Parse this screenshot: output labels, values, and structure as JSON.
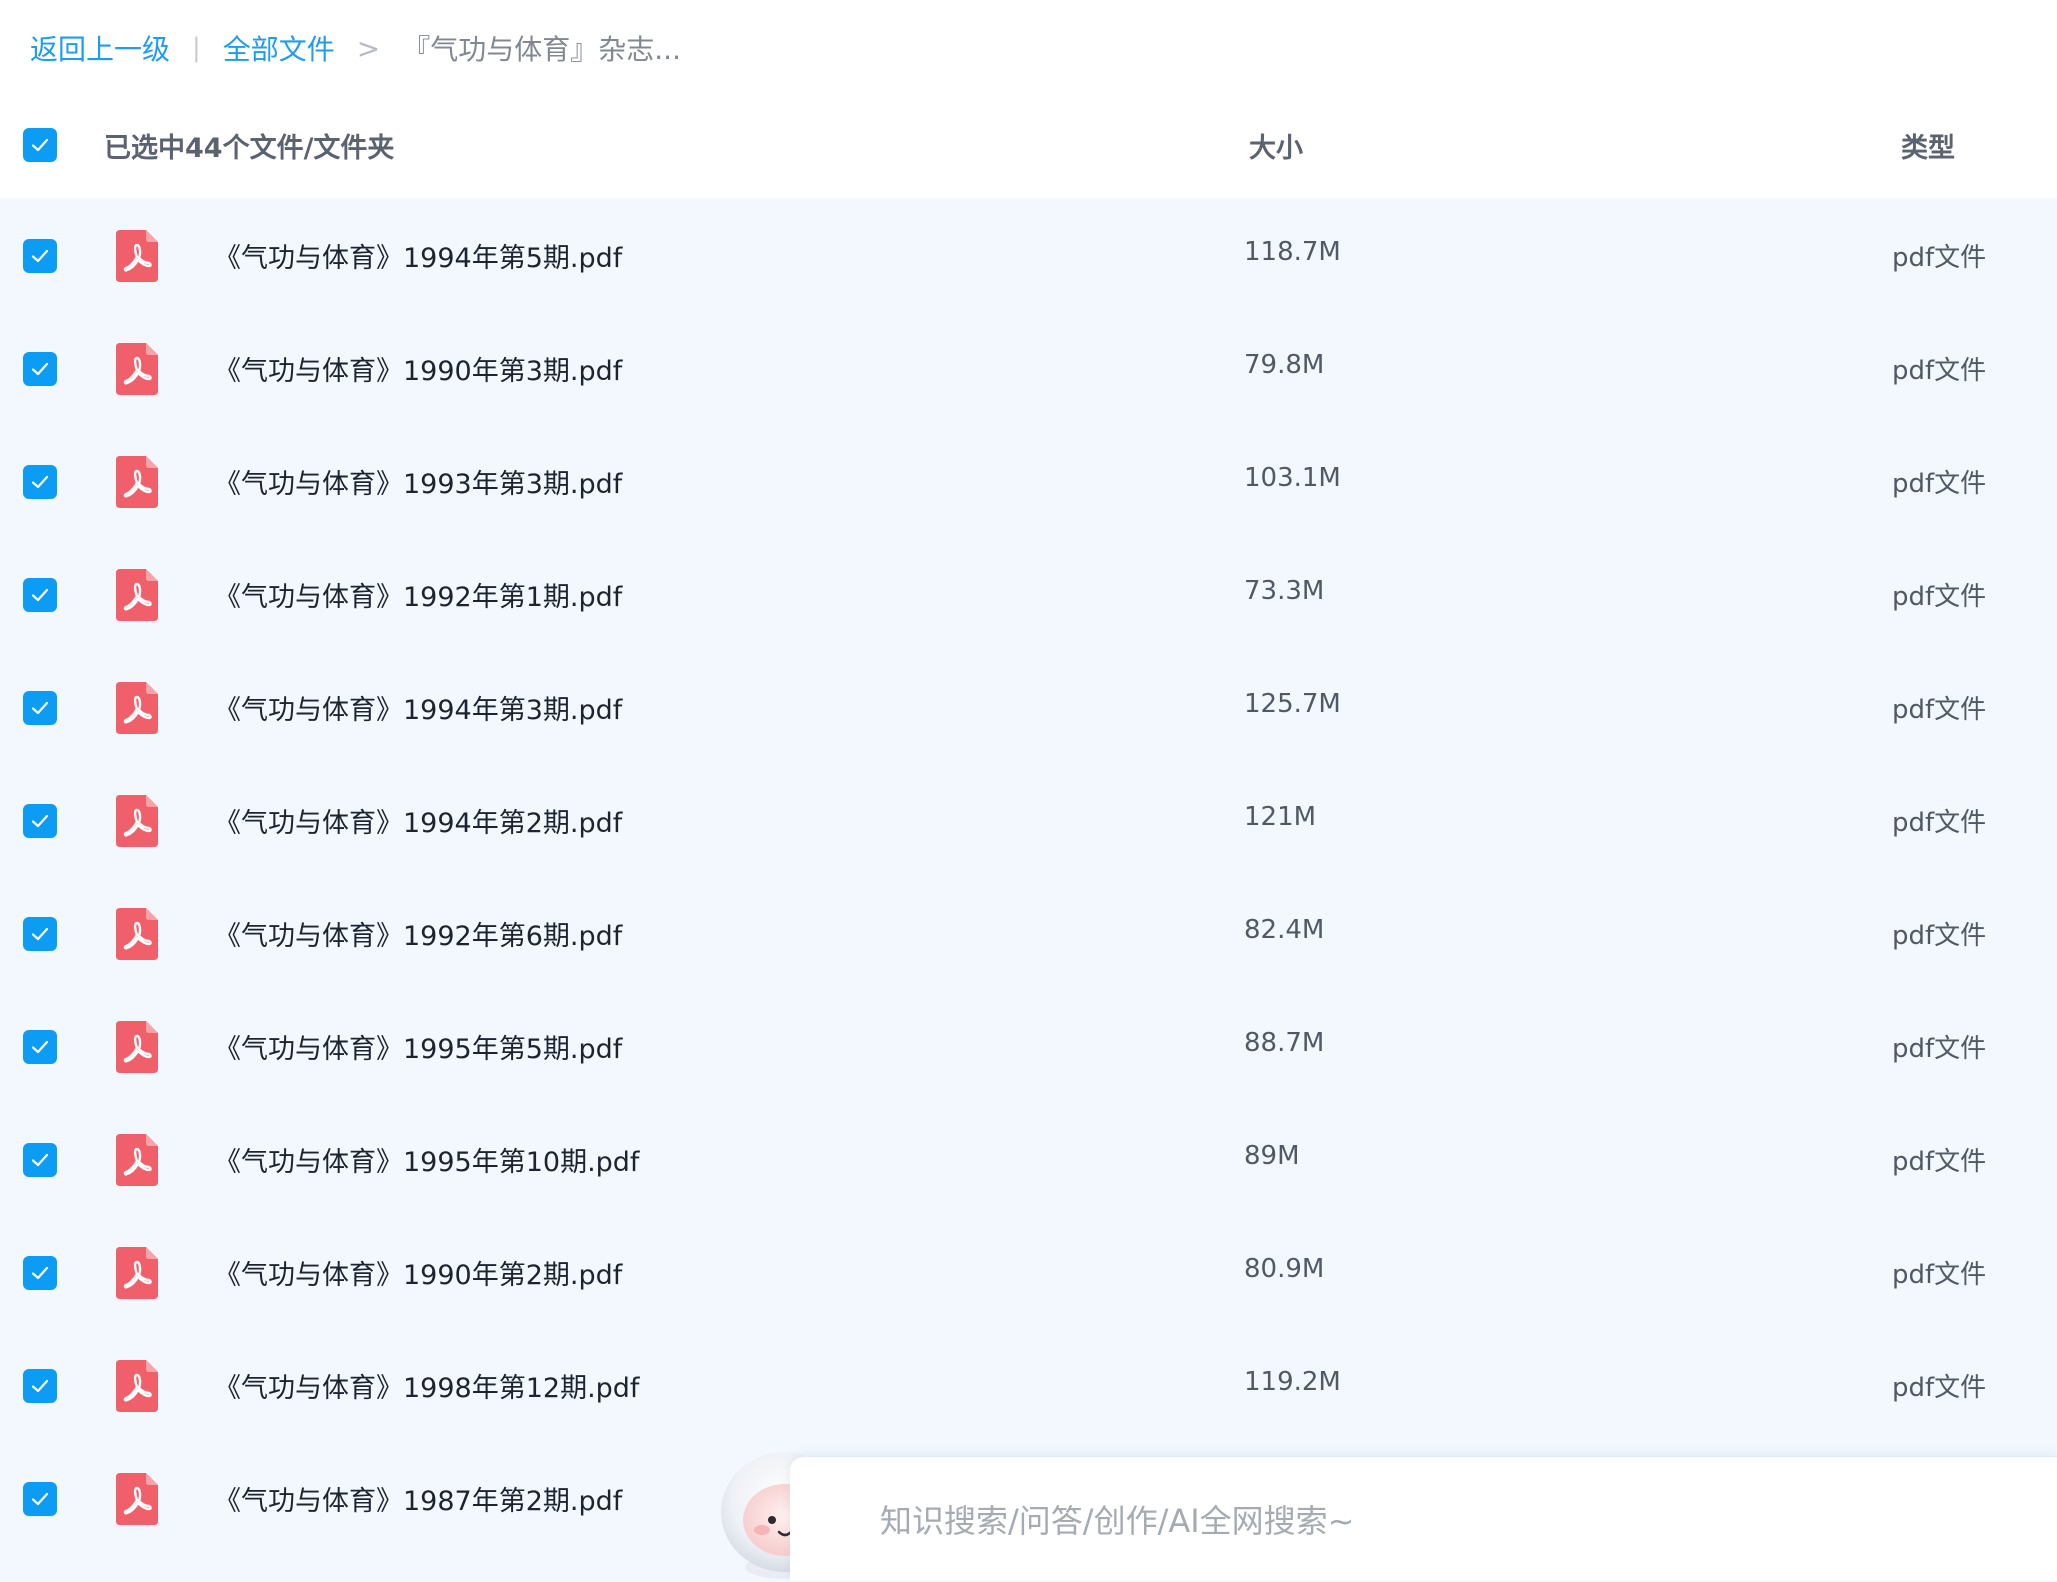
{
  "breadcrumb": {
    "back_label": "返回上一级",
    "divider": "|",
    "root_label": "全部文件",
    "arrow": ">",
    "current_label": "『气功与体育』杂志..."
  },
  "header": {
    "selection_label": "已选中44个文件/文件夹",
    "size_label": "大小",
    "type_label": "类型"
  },
  "icons": {
    "checkbox": "checkbox-checked-icon",
    "file": "pdf-file-icon",
    "mascot": "assistant-mascot-icon"
  },
  "colors": {
    "accent": "#0c9cf3",
    "link": "#1f9bef",
    "pdf": "#f0606a",
    "list_bg": "#f2f8fe"
  },
  "files": [
    {
      "name": "《气功与体育》1994年第5期.pdf",
      "size": "118.7M",
      "type": "pdf文件"
    },
    {
      "name": "《气功与体育》1990年第3期.pdf",
      "size": "79.8M",
      "type": "pdf文件"
    },
    {
      "name": "《气功与体育》1993年第3期.pdf",
      "size": "103.1M",
      "type": "pdf文件"
    },
    {
      "name": "《气功与体育》1992年第1期.pdf",
      "size": "73.3M",
      "type": "pdf文件"
    },
    {
      "name": "《气功与体育》1994年第3期.pdf",
      "size": "125.7M",
      "type": "pdf文件"
    },
    {
      "name": "《气功与体育》1994年第2期.pdf",
      "size": "121M",
      "type": "pdf文件"
    },
    {
      "name": "《气功与体育》1992年第6期.pdf",
      "size": "82.4M",
      "type": "pdf文件"
    },
    {
      "name": "《气功与体育》1995年第5期.pdf",
      "size": "88.7M",
      "type": "pdf文件"
    },
    {
      "name": "《气功与体育》1995年第10期.pdf",
      "size": "89M",
      "type": "pdf文件"
    },
    {
      "name": "《气功与体育》1990年第2期.pdf",
      "size": "80.9M",
      "type": "pdf文件"
    },
    {
      "name": "《气功与体育》1998年第12期.pdf",
      "size": "119.2M",
      "type": "pdf文件"
    },
    {
      "name": "《气功与体育》1987年第2期.pdf",
      "size": "",
      "type": ""
    }
  ],
  "ai_search": {
    "placeholder": "知识搜索/问答/创作/AI全网搜索~"
  }
}
